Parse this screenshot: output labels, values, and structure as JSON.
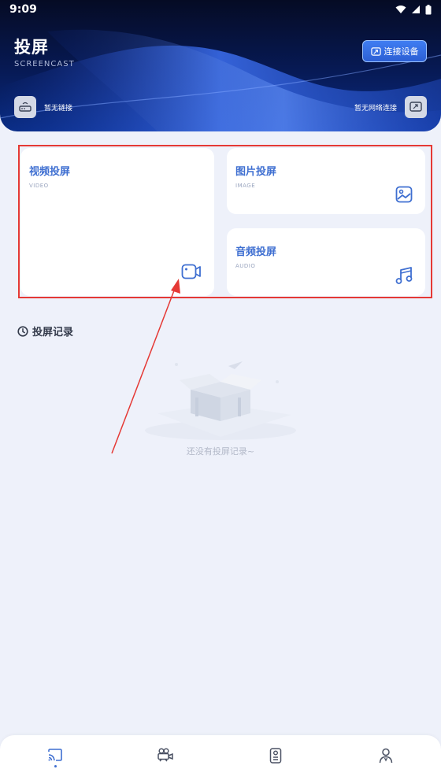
{
  "status_bar": {
    "time": "9:09"
  },
  "header": {
    "title": "投屏",
    "subtitle": "SCREENCAST",
    "connect_button": "连接设备",
    "left_status": "暂无链接",
    "right_status": "暂无网络连接"
  },
  "cards": {
    "video": {
      "title": "视频投屏",
      "sub": "VIDEO"
    },
    "image": {
      "title": "图片投屏",
      "sub": "IMAGE"
    },
    "audio": {
      "title": "音频投屏",
      "sub": "AUDIO"
    }
  },
  "records": {
    "title": "投屏记录",
    "empty_text": "还没有投屏记录~"
  },
  "nav": [
    {
      "icon": "cast-icon",
      "active": true
    },
    {
      "icon": "camera-icon",
      "active": false
    },
    {
      "icon": "remote-icon",
      "active": false
    },
    {
      "icon": "user-icon",
      "active": false
    }
  ],
  "colors": {
    "accent": "#3f6fd1",
    "header_dark": "#050b24",
    "highlight": "#e53935"
  }
}
